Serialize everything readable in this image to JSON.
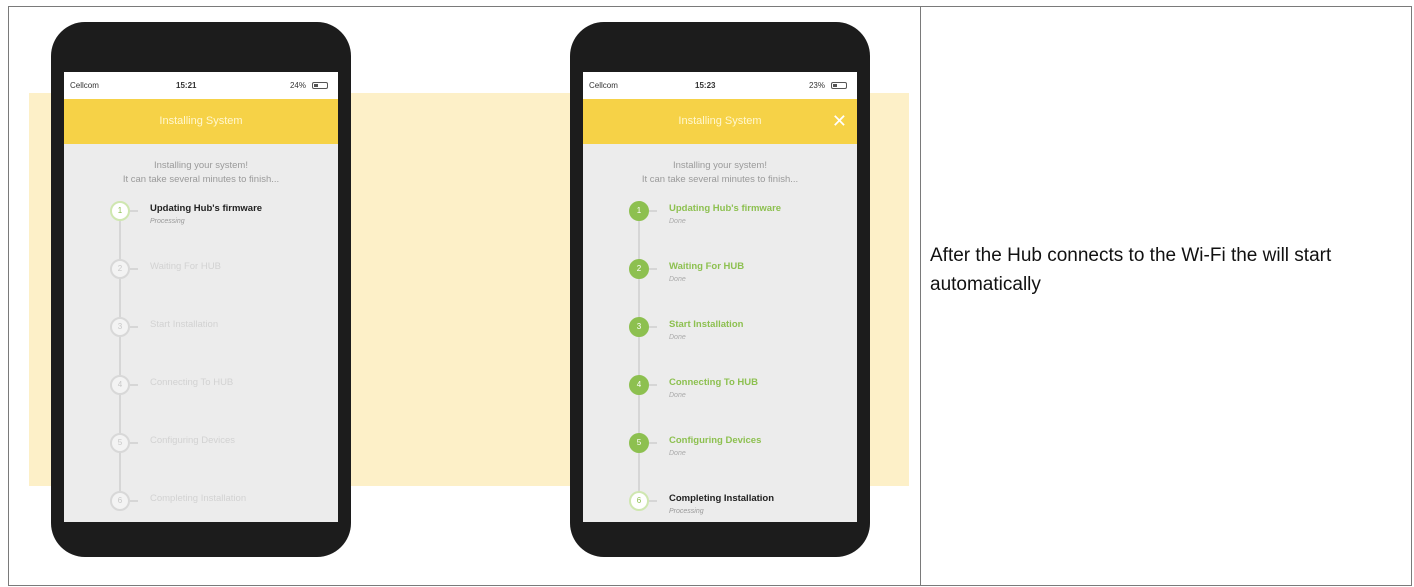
{
  "phones": [
    {
      "status": {
        "carrier": "Cellcom",
        "time": "15:21",
        "battery": "24%"
      },
      "header": {
        "title": "Installing System"
      },
      "intro": [
        "Installing your system!",
        "It can take several minutes to finish..."
      ],
      "steps": [
        {
          "number": "1",
          "label": "Updating Hub's firmware",
          "status": "Processing"
        },
        {
          "number": "2",
          "label": "Waiting For HUB",
          "status": ""
        },
        {
          "number": "3",
          "label": "Start Installation",
          "status": ""
        },
        {
          "number": "4",
          "label": "Connecting To HUB",
          "status": ""
        },
        {
          "number": "5",
          "label": "Configuring Devices",
          "status": ""
        },
        {
          "number": "6",
          "label": "Completing Installation",
          "status": ""
        }
      ]
    },
    {
      "status": {
        "carrier": "Cellcom",
        "time": "15:23",
        "battery": "23%"
      },
      "header": {
        "title": "Installing System",
        "close": "✕"
      },
      "intro": [
        "Installing your system!",
        "It can take several minutes to finish..."
      ],
      "steps": [
        {
          "number": "1",
          "label": "Updating Hub's firmware",
          "status": "Done"
        },
        {
          "number": "2",
          "label": "Waiting For HUB",
          "status": "Done"
        },
        {
          "number": "3",
          "label": "Start Installation",
          "status": "Done"
        },
        {
          "number": "4",
          "label": "Connecting To HUB",
          "status": "Done"
        },
        {
          "number": "5",
          "label": "Configuring Devices",
          "status": "Done"
        },
        {
          "number": "6",
          "label": "Completing Installation",
          "status": "Processing"
        }
      ]
    }
  ],
  "caption": "After the Hub connects to the Wi-Fi the will start automatically"
}
